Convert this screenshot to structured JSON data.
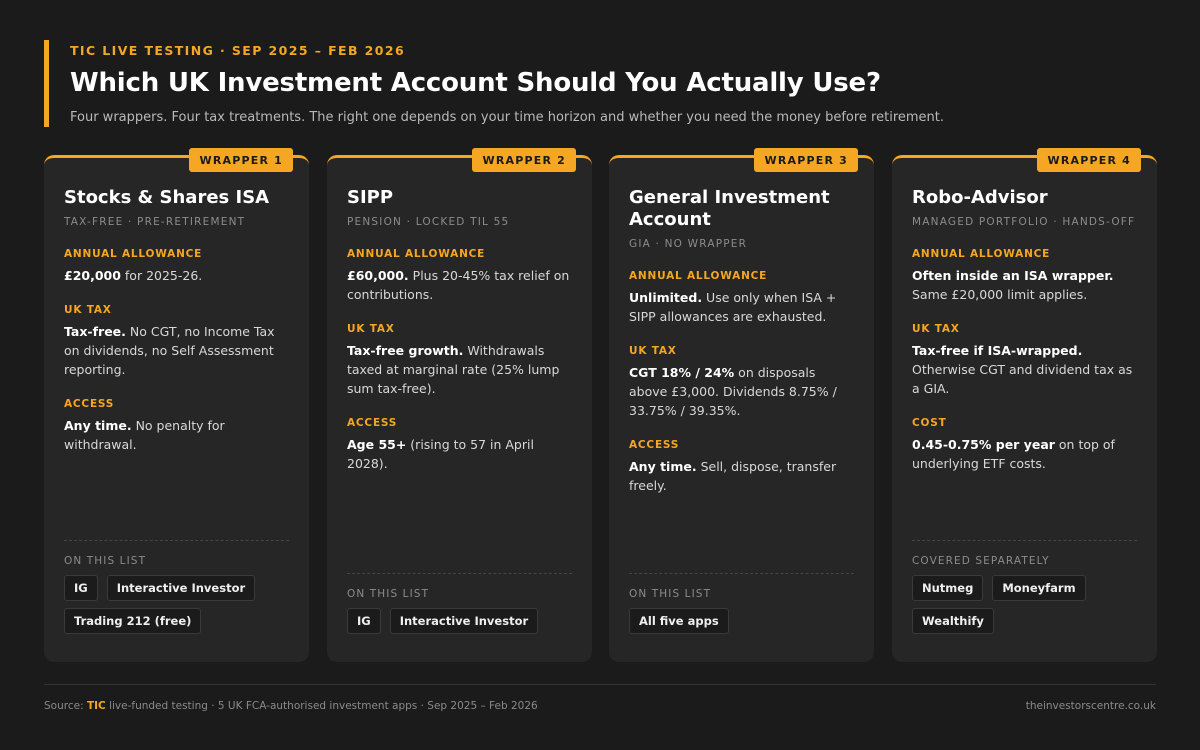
{
  "header": {
    "eyebrow": "TIC LIVE TESTING · SEP 2025 – FEB 2026",
    "title": "Which UK Investment Account Should You Actually Use?",
    "subtitle": "Four wrappers. Four tax treatments. The right one depends on your time horizon and whether you need the money before retirement."
  },
  "cards": [
    {
      "tag": "WRAPPER 1",
      "title": "Stocks & Shares ISA",
      "subtitle": "TAX-FREE · PRE-RETIREMENT",
      "sections": [
        {
          "label": "ANNUAL ALLOWANCE",
          "bold": "£20,000",
          "text": " for 2025-26."
        },
        {
          "label": "UK TAX",
          "bold": "Tax-free.",
          "text": " No CGT, no Income Tax on dividends, no Self Assessment reporting."
        },
        {
          "label": "ACCESS",
          "bold": "Any time.",
          "text": " No penalty for withdrawal."
        }
      ],
      "bottom_label": "ON THIS LIST",
      "chips": [
        "IG",
        "Interactive Investor",
        "Trading 212 (free)"
      ]
    },
    {
      "tag": "WRAPPER 2",
      "title": "SIPP",
      "subtitle": "PENSION · LOCKED TIL 55",
      "sections": [
        {
          "label": "ANNUAL ALLOWANCE",
          "bold": "£60,000.",
          "text": " Plus 20-45% tax relief on contributions."
        },
        {
          "label": "UK TAX",
          "bold": "Tax-free growth.",
          "text": " Withdrawals taxed at marginal rate (25% lump sum tax-free)."
        },
        {
          "label": "ACCESS",
          "bold": "Age 55+",
          "text": " (rising to 57 in April 2028)."
        }
      ],
      "bottom_label": "ON THIS LIST",
      "chips": [
        "IG",
        "Interactive Investor"
      ]
    },
    {
      "tag": "WRAPPER 3",
      "title": "General Investment Account",
      "subtitle": "GIA · NO WRAPPER",
      "sections": [
        {
          "label": "ANNUAL ALLOWANCE",
          "bold": "Unlimited.",
          "text": " Use only when ISA + SIPP allowances are exhausted."
        },
        {
          "label": "UK TAX",
          "bold": "CGT 18% / 24%",
          "text": " on disposals above £3,000. Dividends 8.75% / 33.75% / 39.35%."
        },
        {
          "label": "ACCESS",
          "bold": "Any time.",
          "text": " Sell, dispose, transfer freely."
        }
      ],
      "bottom_label": "ON THIS LIST",
      "chips": [
        "All five apps"
      ]
    },
    {
      "tag": "WRAPPER 4",
      "title": "Robo-Advisor",
      "subtitle": "MANAGED PORTFOLIO · HANDS-OFF",
      "sections": [
        {
          "label": "ANNUAL ALLOWANCE",
          "bold": "Often inside an ISA wrapper.",
          "text": " Same £20,000 limit applies."
        },
        {
          "label": "UK TAX",
          "bold": "Tax-free if ISA-wrapped.",
          "text": " Otherwise CGT and dividend tax as a GIA."
        },
        {
          "label": "COST",
          "bold": "0.45-0.75% per year",
          "text": " on top of underlying ETF costs."
        }
      ],
      "bottom_label": "COVERED SEPARATELY",
      "chips": [
        "Nutmeg",
        "Moneyfarm",
        "Wealthify"
      ]
    }
  ],
  "footer": {
    "source_prefix": "Source: ",
    "source_brand": "TIC",
    "source_text": " live-funded testing · 5 UK FCA-authorised investment apps · Sep 2025 – Feb 2026",
    "site": "theinvestorscentre.co.uk"
  },
  "colors": {
    "accent": "#f5a623",
    "background": "#1b1b1b",
    "card": "#262626"
  }
}
